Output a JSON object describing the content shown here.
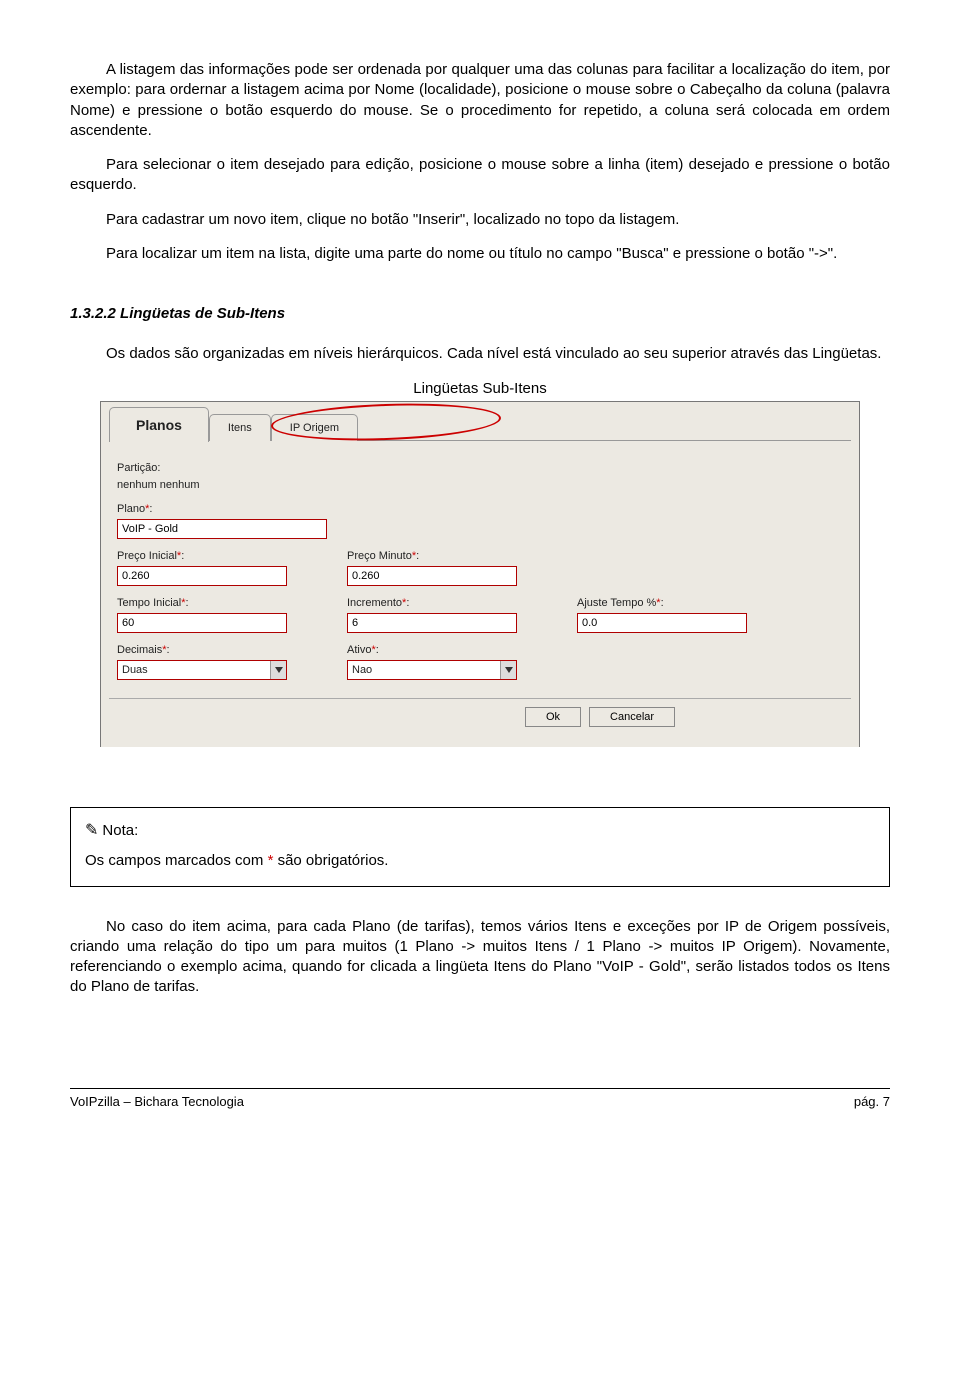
{
  "paragraphs": {
    "p1": "A listagem das informações pode ser ordenada por qualquer uma das colunas para facilitar a localização do item, por exemplo: para ordernar a listagem acima por Nome (localidade), posicione o mouse sobre o Cabeçalho da coluna (palavra Nome) e pressione o botão esquerdo do mouse. Se o procedimento for repetido, a coluna será colocada em ordem ascendente.",
    "p2": "Para selecionar o item desejado para edição, posicione o mouse sobre a linha (item) desejado e pressione o botão esquerdo.",
    "p3": "Para cadastrar um novo item, clique no botão \"Inserir\", localizado no topo da listagem.",
    "p4": "Para localizar um item na lista, digite uma parte do nome ou título no campo \"Busca\" e pressione o botão \"->\".",
    "heading": "1.3.2.2 Lingüetas de Sub-Itens",
    "p5": "Os dados são organizadas em níveis hierárquicos. Cada nível está vinculado ao seu superior através das Lingüetas.",
    "caption": "Lingüetas Sub-Itens",
    "p6": "No caso do item acima, para cada Plano (de tarifas), temos vários Itens e exceções por IP de Origem possíveis, criando uma relação do tipo um para muitos (1 Plano -> muitos Itens / 1 Plano -> muitos IP Origem). Novamente, referenciando o exemplo acima, quando for clicada a lingüeta Itens do Plano \"VoIP - Gold\", serão listados todos os Itens do Plano de tarifas."
  },
  "form": {
    "tabs": {
      "t0": "Planos",
      "t1": "Itens",
      "t2": "IP Origem"
    },
    "particao_label": "Partição:",
    "particao_value": "nenhum nenhum",
    "plano_label": "Plano",
    "plano_value": "VoIP - Gold",
    "preco_inicial_label": "Preço Inicial",
    "preco_inicial_value": "0.260",
    "preco_minuto_label": "Preço Minuto",
    "preco_minuto_value": "0.260",
    "tempo_inicial_label": "Tempo Inicial",
    "tempo_inicial_value": "60",
    "incremento_label": "Incremento",
    "incremento_value": "6",
    "ajuste_label": "Ajuste Tempo %",
    "ajuste_value": "0.0",
    "decimais_label": "Decimais",
    "decimais_value": "Duas",
    "ativo_label": "Ativo",
    "ativo_value": "Nao",
    "ok": "Ok",
    "cancelar": "Cancelar",
    "req_mark": "*",
    "colon": ":"
  },
  "note": {
    "title": "Nota:",
    "body_pre": "Os campos marcados com ",
    "star": "*",
    "body_post": " são obrigatórios."
  },
  "footer": {
    "left": "VoIPzilla – Bichara Tecnologia",
    "right": "pág. 7"
  }
}
